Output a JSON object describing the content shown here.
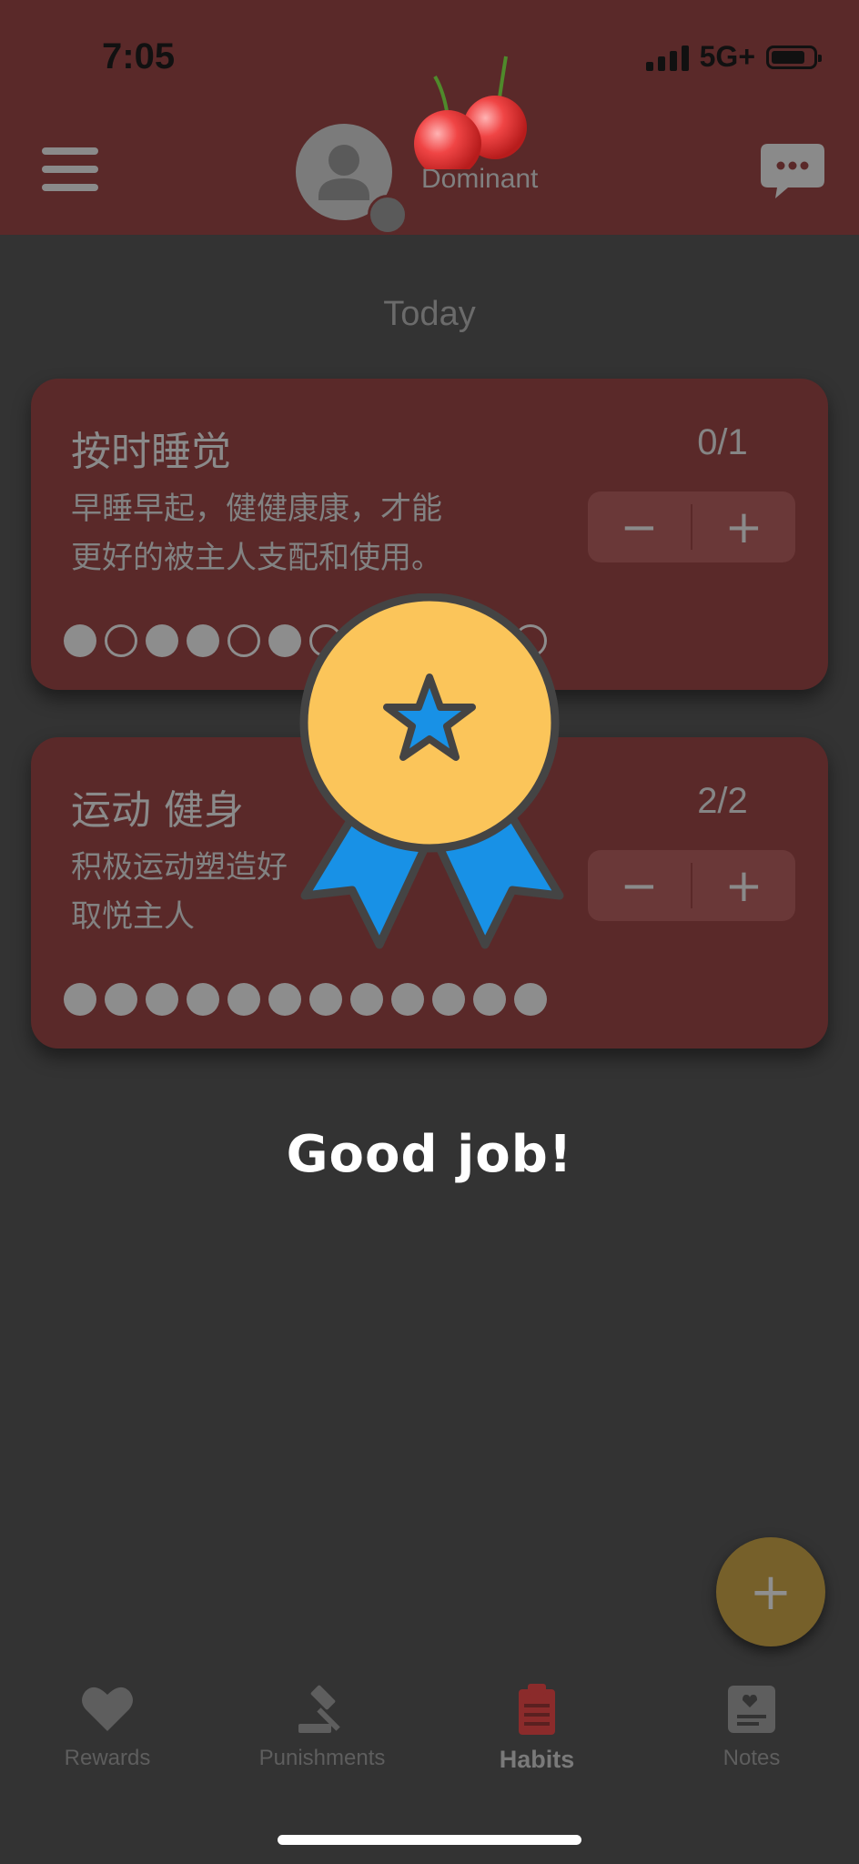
{
  "status_bar": {
    "time": "7:05",
    "network": "5G+"
  },
  "header": {
    "role": "Dominant"
  },
  "section_title": "Today",
  "habits": [
    {
      "title": "按时睡觉",
      "description_line1": "早睡早起，健健康康，才能",
      "description_line2": "更好的被主人支配和使用。",
      "progress": "0/1",
      "minus": "−",
      "plus": "+",
      "history": [
        true,
        false,
        true,
        true,
        false,
        true,
        false,
        false,
        false,
        false,
        false,
        false
      ]
    },
    {
      "title": "运动 健身",
      "description_line1": "积极运动塑造好",
      "description_line2": "取悦主人",
      "progress": "2/2",
      "minus": "−",
      "plus": "+",
      "history": [
        true,
        true,
        true,
        true,
        true,
        true,
        true,
        true,
        true,
        true,
        true,
        true
      ]
    }
  ],
  "overlay": {
    "message": "Good job!"
  },
  "fab_label": "+",
  "nav": {
    "rewards": "Rewards",
    "punishments": "Punishments",
    "habits": "Habits",
    "notes": "Notes",
    "active": "habits"
  },
  "colors": {
    "header": "#5a2929",
    "background": "#333333",
    "card": "#5a2929",
    "accent_habits": "#8b2b2b",
    "fab": "#76602a",
    "medal_gold": "#fbc55a",
    "medal_ribbon": "#1891e6"
  }
}
